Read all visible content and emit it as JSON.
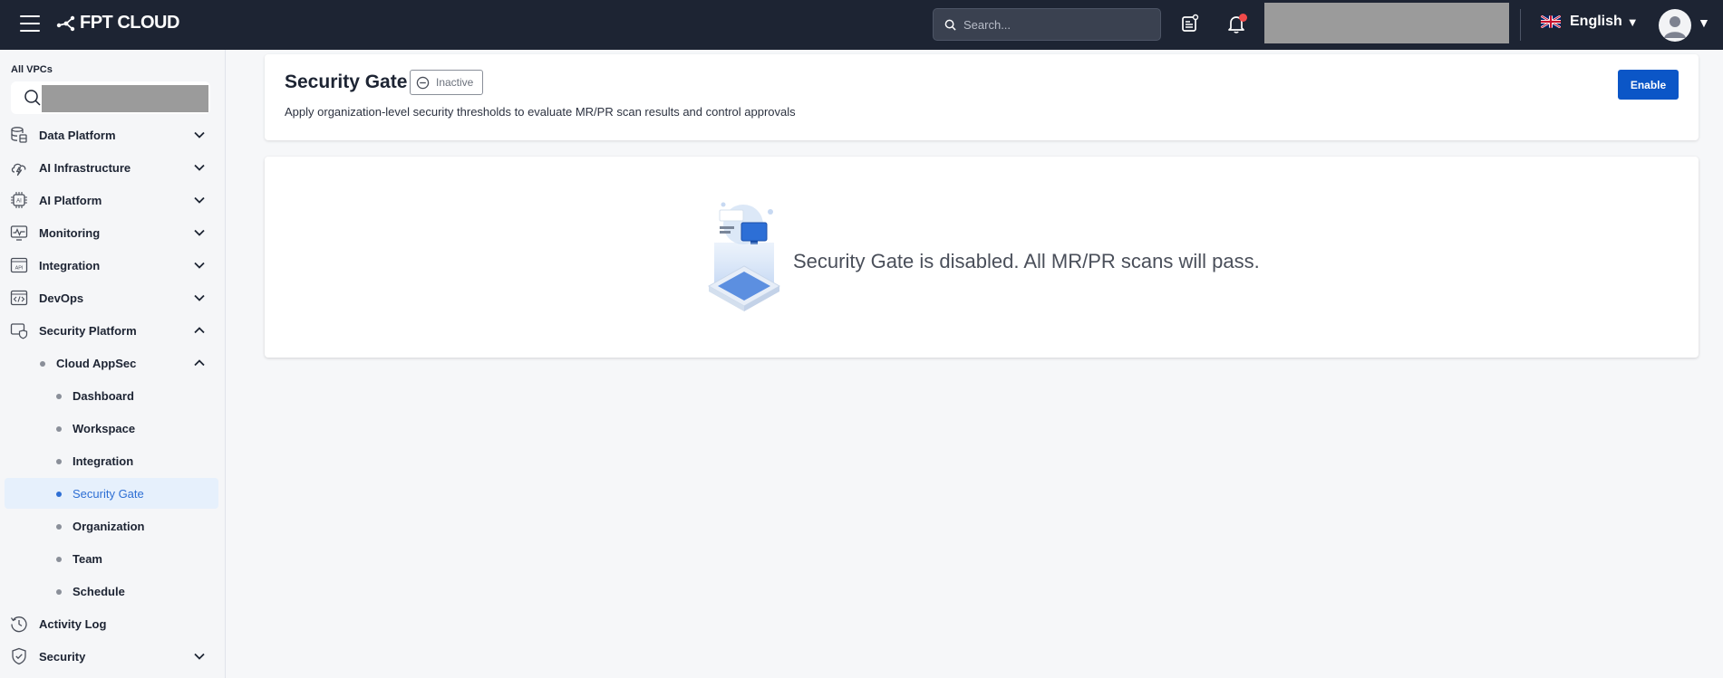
{
  "topbar": {
    "logo_text": "FPT CLOUD",
    "search_placeholder": "Search...",
    "language": "English"
  },
  "sidebar": {
    "vpc_label": "All VPCs",
    "items": [
      {
        "label": "Data Platform",
        "icon": "database-icon"
      },
      {
        "label": "AI Infrastructure",
        "icon": "cloud-bolt-icon"
      },
      {
        "label": "AI Platform",
        "icon": "ai-chip-icon"
      },
      {
        "label": "Monitoring",
        "icon": "monitor-pulse-icon"
      },
      {
        "label": "Integration",
        "icon": "api-icon"
      },
      {
        "label": "DevOps",
        "icon": "code-window-icon"
      },
      {
        "label": "Security Platform",
        "icon": "shield-window-icon"
      }
    ],
    "cloud_appsec": "Cloud AppSec",
    "sub_items": [
      "Dashboard",
      "Workspace",
      "Integration",
      "Security Gate",
      "Organization",
      "Team",
      "Schedule"
    ],
    "active_sub_item": "Security Gate",
    "activity_log": "Activity Log",
    "security": "Security"
  },
  "header": {
    "title": "Security Gate",
    "status": "Inactive",
    "description": "Apply organization-level security thresholds to evaluate MR/PR scan results and control approvals",
    "enable_label": "Enable"
  },
  "empty_state": {
    "message": "Security Gate is disabled. All MR/PR scans will pass."
  },
  "colors": {
    "topbar_bg": "#1d2433",
    "primary": "#0b56c7",
    "active_text": "#2e6fd4",
    "active_bg": "#e6f0fc",
    "notification": "#f04a4a"
  }
}
